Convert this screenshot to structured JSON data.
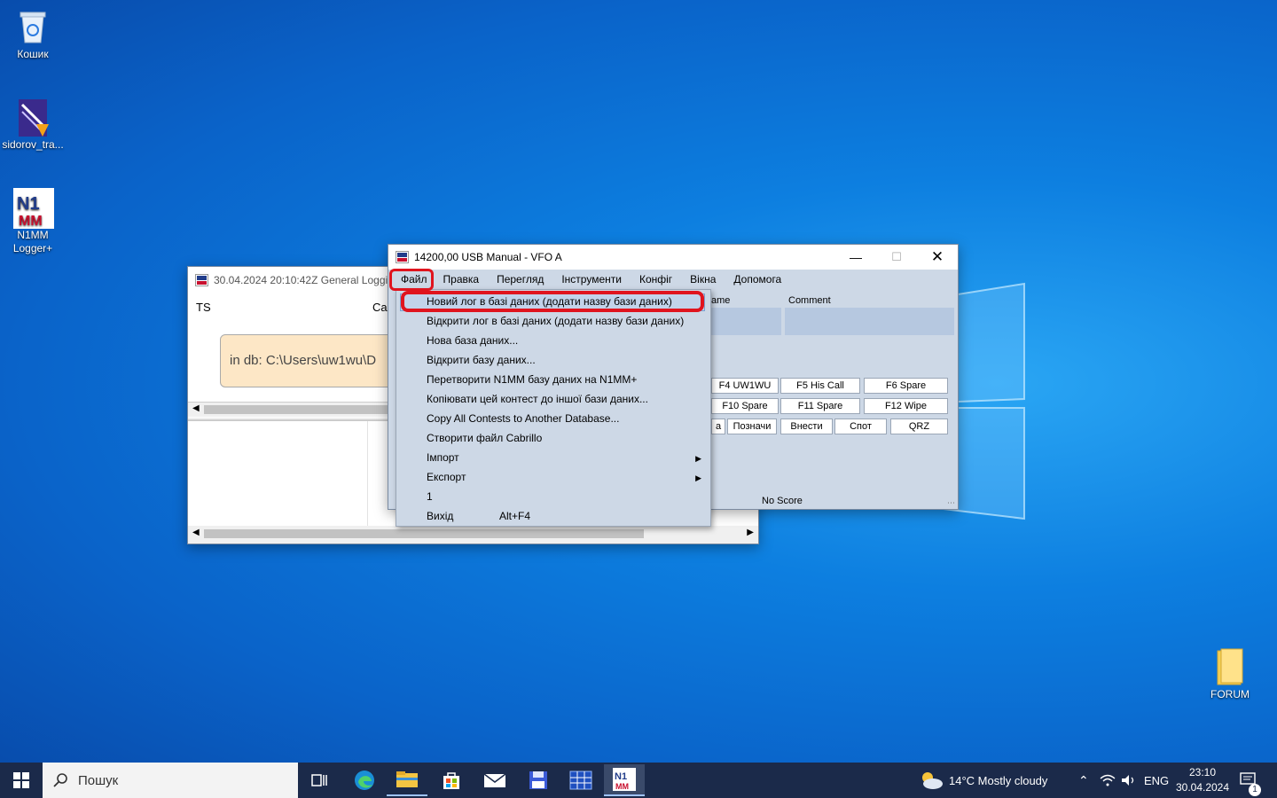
{
  "desktop": {
    "icons": [
      {
        "label": "Кошик"
      },
      {
        "label": "sidorov_tra..."
      },
      {
        "label": "N1MM Logger+"
      },
      {
        "label": "FORUM"
      }
    ]
  },
  "log_window": {
    "title": "30.04.2024 20:10:42Z  General Logging",
    "col_ts": "TS",
    "col_call": "Ca",
    "db_text": "in db: C:\\Users\\uw1wu\\D"
  },
  "entry_window": {
    "title": "14200,00 USB Manual - VFO A",
    "menu": [
      "Файл",
      "Правка",
      "Перегляд",
      "Інструменти",
      "Конфіг",
      "Вікна",
      "Допомога"
    ],
    "field_name": "ame",
    "field_comment": "Comment",
    "fkeys": [
      "F4 UW1WU",
      "F5 His Call",
      "F6 Spare",
      "F10 Spare",
      "F11 Spare",
      "F12 Wipe",
      "a",
      "Позначи",
      "Внести",
      "Спот",
      "QRZ"
    ],
    "status": "No Score"
  },
  "file_menu": {
    "items": [
      {
        "label": "Новий лог в базі даних (додати назву бази даних)"
      },
      {
        "label": "Відкрити лог в базі даних (додати назву бази даних)"
      },
      {
        "label": "Нова база даних..."
      },
      {
        "label": "Відкрити базу даних..."
      },
      {
        "label": "Перетворити N1MM базу даних на N1MM+"
      },
      {
        "label": "Копіювати цей контест до іншої бази даних..."
      },
      {
        "label": "Copy All Contests to Another Database..."
      },
      {
        "label": "Створити файл Cabrillo"
      },
      {
        "label": "Імпорт"
      },
      {
        "label": "Експорт"
      },
      {
        "label": "1"
      },
      {
        "label": "Вихід"
      }
    ],
    "exit_shortcut": "Alt+F4"
  },
  "taskbar": {
    "search_placeholder": "Пошук",
    "weather": "14°C  Mostly cloudy",
    "lang": "ENG",
    "time": "23:10",
    "date": "30.04.2024",
    "notif_count": "1"
  },
  "colors": {
    "highlight": "#e0141e",
    "menu_bg": "#cdd8e6",
    "selection": "#c2d3ea"
  }
}
